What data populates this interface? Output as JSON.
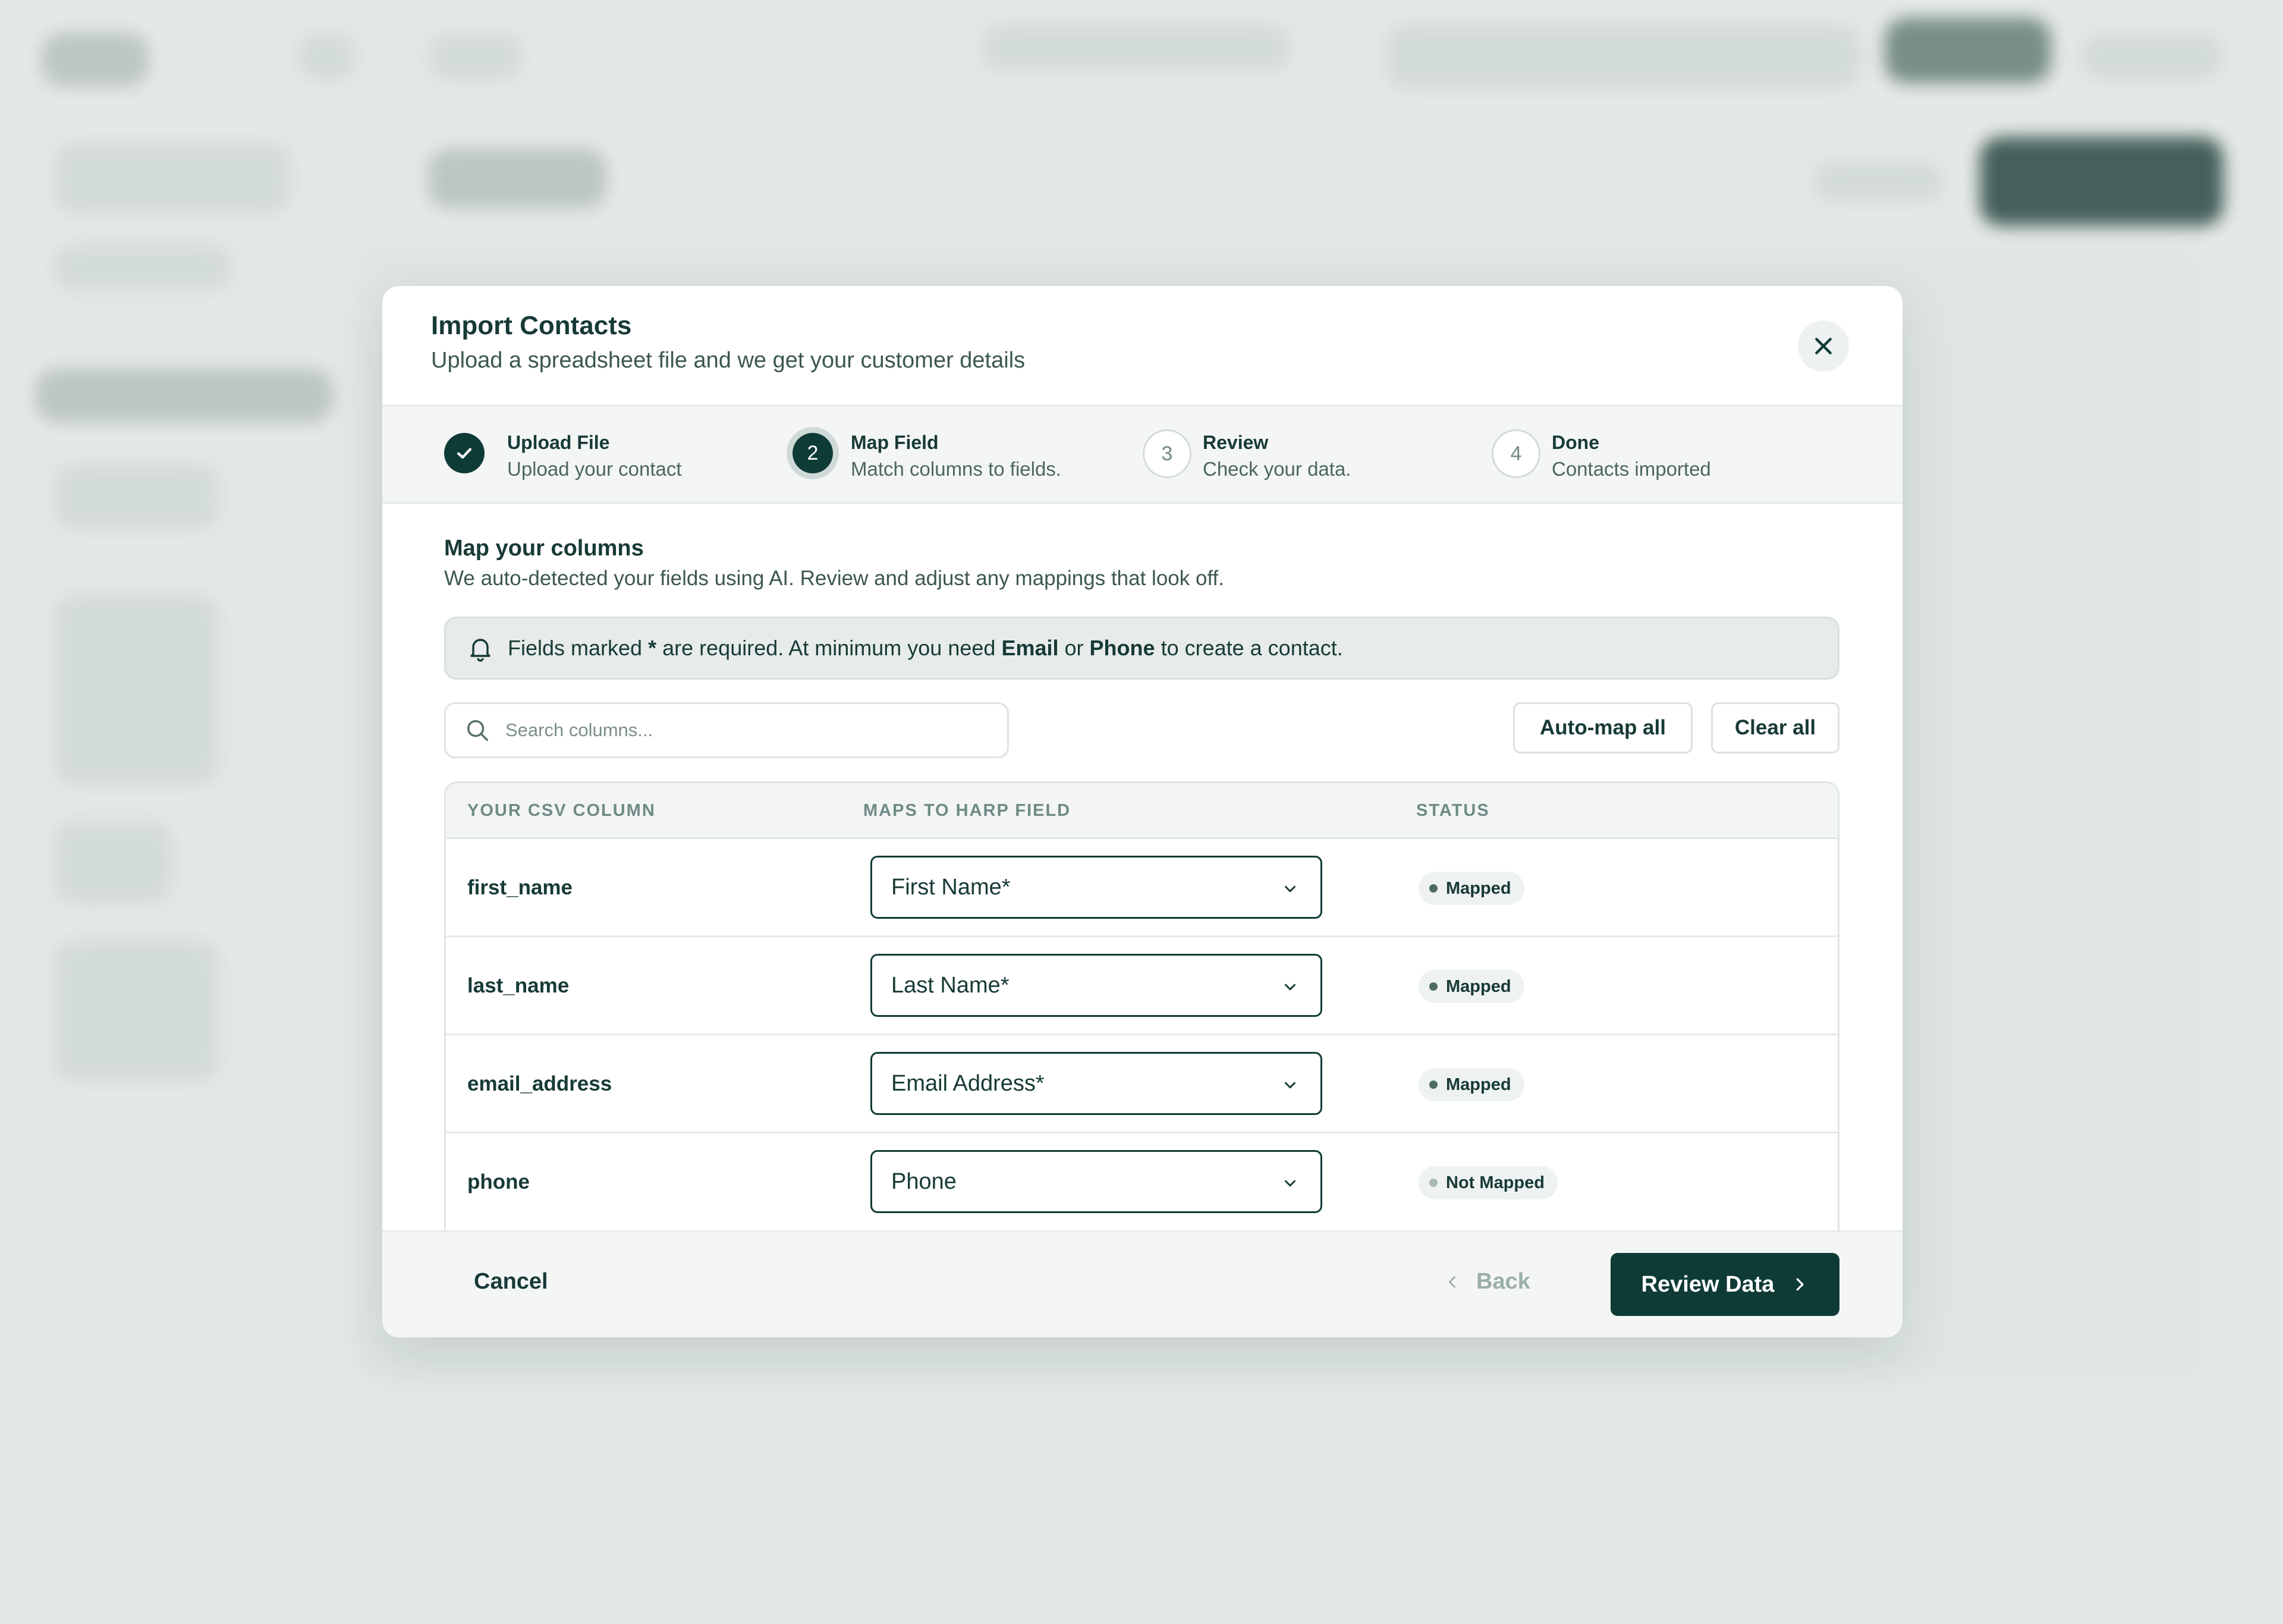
{
  "modal": {
    "title": "Import Contacts",
    "subtitle": "Upload a spreadsheet file and we get your customer details"
  },
  "steps": [
    {
      "number": "1",
      "title": "Upload File",
      "description": "Upload your contact",
      "state": "completed"
    },
    {
      "number": "2",
      "title": "Map Field",
      "description": "Match columns to fields.",
      "state": "active"
    },
    {
      "number": "3",
      "title": "Review",
      "description": "Check your data.",
      "state": "upcoming"
    },
    {
      "number": "4",
      "title": "Done",
      "description": "Contacts imported",
      "state": "upcoming"
    }
  ],
  "mapping": {
    "title": "Map your columns",
    "description": "We auto-detected your fields using AI. Review and adjust any mappings that look off."
  },
  "notice": {
    "text_1": "Fields marked",
    "star": "*",
    "text_2": "are required. At minimum you need",
    "email": "Email",
    "or": "or",
    "phone": "Phone",
    "text_3": "to create a contact."
  },
  "search": {
    "placeholder": "Search columns..."
  },
  "actions": {
    "auto_map": "Auto-map all",
    "clear_all": "Clear all"
  },
  "table": {
    "headers": [
      "YOUR CSV COLUMN",
      "MAPS TO HARP FIELD",
      "STATUS"
    ],
    "rows": [
      {
        "column": "first_name",
        "field": "First Name*",
        "status": "Mapped"
      },
      {
        "column": "last_name",
        "field": "Last Name*",
        "status": "Mapped"
      },
      {
        "column": "email_address",
        "field": "Email Address*",
        "status": "Mapped"
      },
      {
        "column": "phone",
        "field": "Phone",
        "status": "Not Mapped"
      }
    ]
  },
  "footer": {
    "cancel": "Cancel",
    "back": "Back",
    "next": "Review Data"
  },
  "colors": {
    "primary": "#0f3b36",
    "status_mapped_dot": "#4f6b66",
    "status_unmapped_dot": "#a9bab6"
  }
}
